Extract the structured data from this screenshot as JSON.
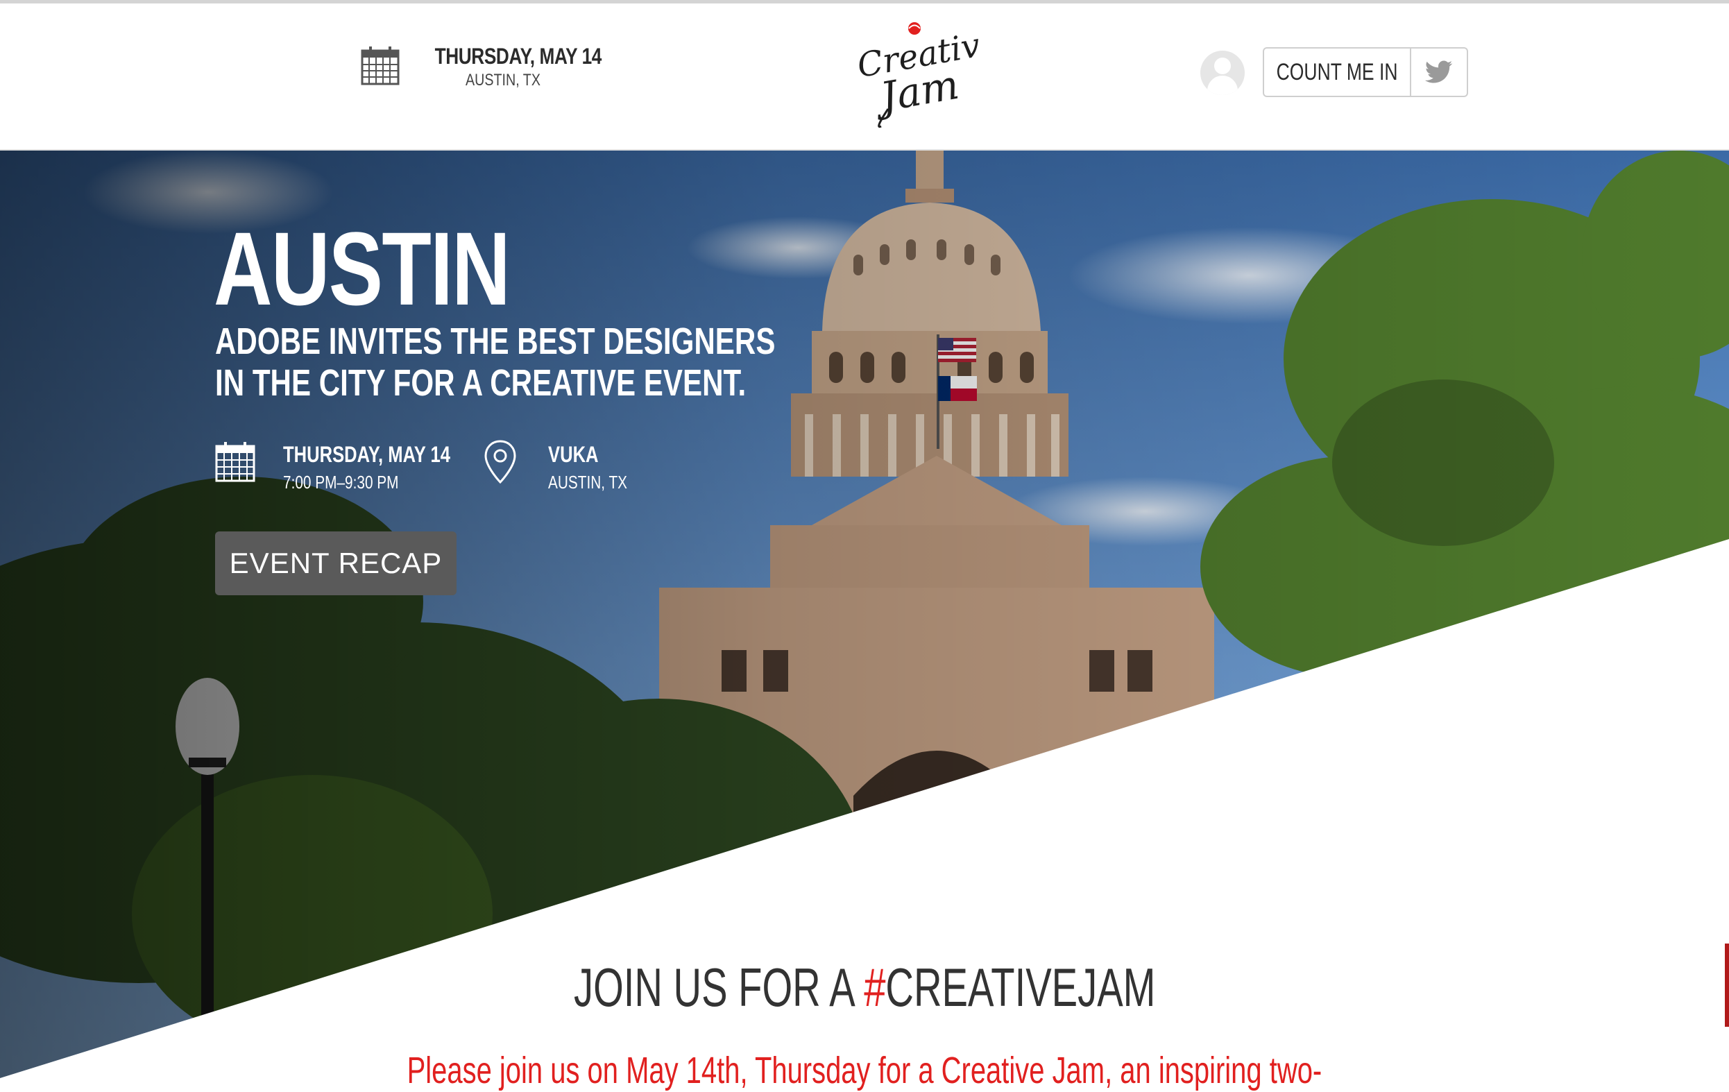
{
  "header": {
    "date": "THURSDAY, MAY 14",
    "city": "AUSTIN, TX",
    "logo_alt": "Creative Jam",
    "count_me_in": "COUNT ME IN"
  },
  "hero": {
    "title": "AUSTIN",
    "subtitle_line1": "ADOBE INVITES THE BEST DESIGNERS",
    "subtitle_line2": "IN THE CITY FOR A CREATIVE EVENT.",
    "date": "THURSDAY, MAY 14",
    "time": "7:00 PM–9:30 PM",
    "venue": "VUKA",
    "venue_city": "AUSTIN, TX",
    "recap_button": "EVENT RECAP"
  },
  "section": {
    "join_prefix": "JOIN US FOR A ",
    "join_hash": "#",
    "join_suffix": "CREATIVEJAM",
    "intro": "Please join us on May 14th, Thursday for a Creative Jam, an inspiring two-"
  },
  "colors": {
    "accent": "#e1201f",
    "button_gray": "#5a5a5a",
    "text_dark": "#333333"
  },
  "icons": [
    "calendar-icon",
    "creative-jam-logo",
    "user-avatar-icon",
    "twitter-icon",
    "location-pin-icon"
  ]
}
